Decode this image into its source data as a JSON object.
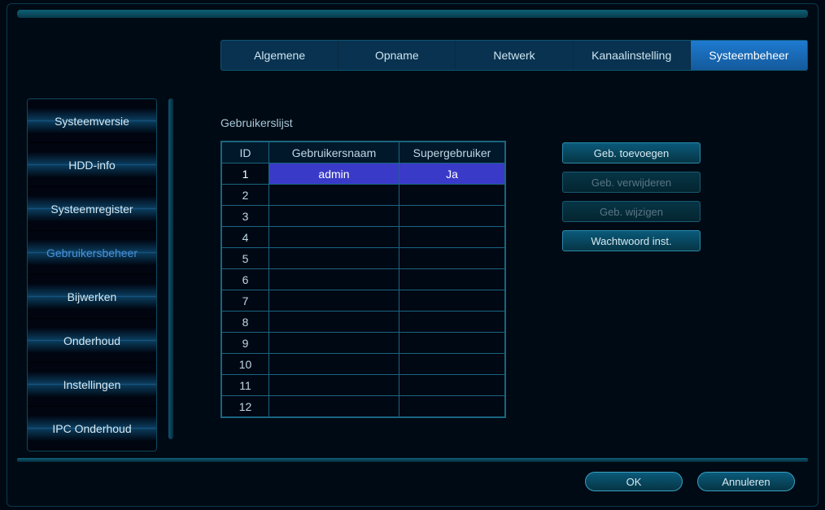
{
  "main_tabs": [
    {
      "label": "Algemene",
      "active": false
    },
    {
      "label": "Opname",
      "active": false
    },
    {
      "label": "Netwerk",
      "active": false
    },
    {
      "label": "Kanaalinstelling",
      "active": false
    },
    {
      "label": "Systeembeheer",
      "active": true
    }
  ],
  "sidebar_items": [
    {
      "label": "Systeemversie",
      "active": false
    },
    {
      "label": "HDD-info",
      "active": false
    },
    {
      "label": "Systeemregister",
      "active": false
    },
    {
      "label": "Gebruikersbeheer",
      "active": true
    },
    {
      "label": "Bijwerken",
      "active": false
    },
    {
      "label": "Onderhoud",
      "active": false
    },
    {
      "label": "Instellingen",
      "active": false
    },
    {
      "label": "IPC Onderhoud",
      "active": false
    }
  ],
  "section_title": "Gebruikerslijst",
  "table": {
    "headers": {
      "id": "ID",
      "username": "Gebruikersnaam",
      "super": "Supergebruiker"
    },
    "rows": [
      {
        "id": "1",
        "username": "admin",
        "super": "Ja",
        "selected": true
      },
      {
        "id": "2",
        "username": "",
        "super": "",
        "selected": false
      },
      {
        "id": "3",
        "username": "",
        "super": "",
        "selected": false
      },
      {
        "id": "4",
        "username": "",
        "super": "",
        "selected": false
      },
      {
        "id": "5",
        "username": "",
        "super": "",
        "selected": false
      },
      {
        "id": "6",
        "username": "",
        "super": "",
        "selected": false
      },
      {
        "id": "7",
        "username": "",
        "super": "",
        "selected": false
      },
      {
        "id": "8",
        "username": "",
        "super": "",
        "selected": false
      },
      {
        "id": "9",
        "username": "",
        "super": "",
        "selected": false
      },
      {
        "id": "10",
        "username": "",
        "super": "",
        "selected": false
      },
      {
        "id": "11",
        "username": "",
        "super": "",
        "selected": false
      },
      {
        "id": "12",
        "username": "",
        "super": "",
        "selected": false
      }
    ]
  },
  "action_buttons": [
    {
      "label": "Geb. toevoegen",
      "disabled": false
    },
    {
      "label": "Geb. verwijderen",
      "disabled": true
    },
    {
      "label": "Geb. wijzigen",
      "disabled": true
    },
    {
      "label": "Wachtwoord inst.",
      "disabled": false
    }
  ],
  "bottom_buttons": {
    "ok": "OK",
    "cancel": "Annuleren"
  }
}
